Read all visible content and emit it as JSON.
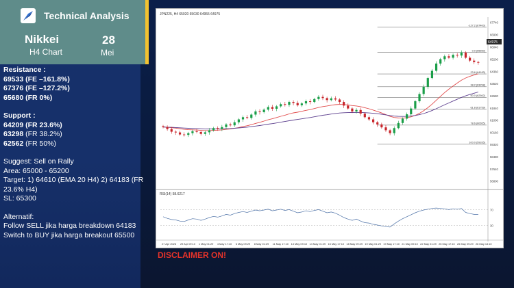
{
  "header": {
    "title": "Technical Analysis",
    "market": "Nikkei",
    "timeframe": "H4 Chart",
    "day": "28",
    "month": "Mei"
  },
  "resistance": {
    "label": "Resistance :",
    "items": [
      "69533 (FE –161.8%)",
      "67376 (FE –127.2%)",
      "65680 (FR 0%)"
    ]
  },
  "support": {
    "label": "Support :",
    "items": [
      {
        "value": "64209",
        "note": " (FR 23.6%)",
        "value_bold": true
      },
      {
        "value": "63298",
        "note": " (FR 38.2%)",
        "value_bold": true
      },
      {
        "value": "62562",
        "note": " (FR 50%)",
        "value_bold": true
      }
    ]
  },
  "suggest": {
    "line1": "Suggest: Sell on Rally",
    "line2": "Area: 65000 - 65200",
    "line3": "Target: 1) 64610 (EMA 20 H4) 2) 64183 (FR",
    "line4": "23.6% H4)",
    "line5": "SL: 65300"
  },
  "alternatif": {
    "label": "Alternatif:",
    "line1": "Follow SELL jika harga breakdown 64183",
    "line2": "Switch to BUY jika harga breakout 65500"
  },
  "disclaimer": "DISCLAIMER ON!",
  "chart_window": {
    "title": "JPN225, H4  65020 65030 64955 64975",
    "rsi_label": "RSI(14) 58.6217",
    "last_price": "64975",
    "colors": {
      "bull": "#1a9e48",
      "bear": "#c8262b",
      "ema_fast": "#e14a4a",
      "ema_slow": "#5a3c8c",
      "rsi": "#4a6fa5",
      "fib": "#555555"
    }
  },
  "chart_data": {
    "type": "candlestick",
    "price_scale_labels": [
      "67740",
      "66900",
      "66040",
      "65200",
      "64360",
      "63520",
      "62680",
      "61840",
      "61000",
      "60160",
      "59320",
      "58480",
      "57640",
      "56800"
    ],
    "fib_levels": [
      {
        "label": "-127.2 (67400)",
        "price": 67400
      },
      {
        "label": "0.0 (65660)",
        "price": 65660
      },
      {
        "label": "23.6 (64183)",
        "price": 64183
      },
      {
        "label": "38.2 (63298)",
        "price": 63298
      },
      {
        "label": "50.0 (62562)",
        "price": 62562
      },
      {
        "label": "61.8 (61759)",
        "price": 61759
      },
      {
        "label": "78.6 (60655)",
        "price": 60655
      },
      {
        "label": "100.0 (59335)",
        "price": 59335
      }
    ],
    "x_labels": [
      "27 Apr 2026",
      "29 Apr 09:10",
      "1 May 01:29",
      "4 May 17:10",
      "6 May 09:29",
      "8 May 01:29",
      "11 May 17:10",
      "13 May 09:10",
      "14 May 01:29",
      "15 May 17:10",
      "18 May 09:29",
      "19 May 01:29",
      "19 May 17:10",
      "21 May 09:10",
      "22 May 01:29",
      "25 May 17:10",
      "26 May 09:29",
      "26 May 13:10"
    ],
    "closes": [
      60520,
      60380,
      60200,
      60150,
      60010,
      59980,
      60100,
      60230,
      60180,
      60050,
      60160,
      60300,
      60450,
      60380,
      60520,
      60700,
      60640,
      60850,
      61050,
      61200,
      61150,
      61380,
      61600,
      61550,
      61720,
      61900,
      61780,
      61950,
      62100,
      62050,
      62250,
      62180,
      62020,
      62150,
      62300,
      62250,
      62450,
      62600,
      62520,
      62380,
      62500,
      62420,
      62250,
      62000,
      61800,
      61600,
      61700,
      61450,
      61200,
      61050,
      60850,
      60700,
      60500,
      60300,
      60100,
      60450,
      60800,
      61100,
      61400,
      61800,
      62300,
      62800,
      63300,
      63900,
      64400,
      64900,
      65200,
      65400,
      65300,
      65500,
      65450,
      65660,
      65300,
      65100,
      65000,
      64975
    ],
    "rsi_values": [
      52,
      48,
      45,
      44,
      41,
      40,
      44,
      47,
      46,
      43,
      46,
      50,
      53,
      51,
      54,
      58,
      56,
      60,
      63,
      65,
      63,
      66,
      69,
      67,
      69,
      71,
      67,
      69,
      71,
      68,
      70,
      66,
      62,
      64,
      67,
      65,
      68,
      70,
      66,
      62,
      64,
      61,
      56,
      50,
      46,
      43,
      46,
      41,
      37,
      36,
      33,
      31,
      29,
      27,
      26,
      34,
      41,
      47,
      52,
      57,
      62,
      66,
      69,
      71,
      73,
      74,
      73,
      72,
      70,
      72,
      71,
      73,
      63,
      60,
      58,
      58
    ],
    "rsi_levels": [
      70,
      30
    ]
  }
}
